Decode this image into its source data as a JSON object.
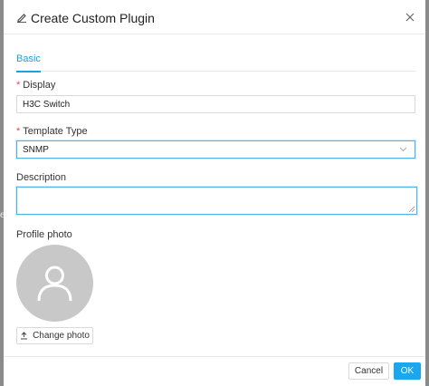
{
  "backdrop": {
    "edge_text": "e"
  },
  "dialog": {
    "title": "Create Custom Plugin",
    "title_icon": "edit-icon",
    "close_icon": "close-icon"
  },
  "tabs": [
    {
      "label": "Basic",
      "active": true
    }
  ],
  "form": {
    "display": {
      "label": "Display",
      "required": true,
      "value": "H3C Switch"
    },
    "template_type": {
      "label": "Template Type",
      "required": true,
      "value": "SNMP",
      "icon": "chevron-down-icon"
    },
    "description": {
      "label": "Description",
      "value": ""
    },
    "profile_photo": {
      "label": "Profile photo",
      "avatar_icon": "user-icon",
      "button_label": "Change photo",
      "button_icon": "upload-icon"
    }
  },
  "footer": {
    "cancel_label": "Cancel",
    "ok_label": "OK"
  },
  "colors": {
    "accent": "#1aa7ef",
    "required": "#e5484d",
    "avatar_bg": "#c8c8c8",
    "backdrop": "#8a8a8a"
  }
}
